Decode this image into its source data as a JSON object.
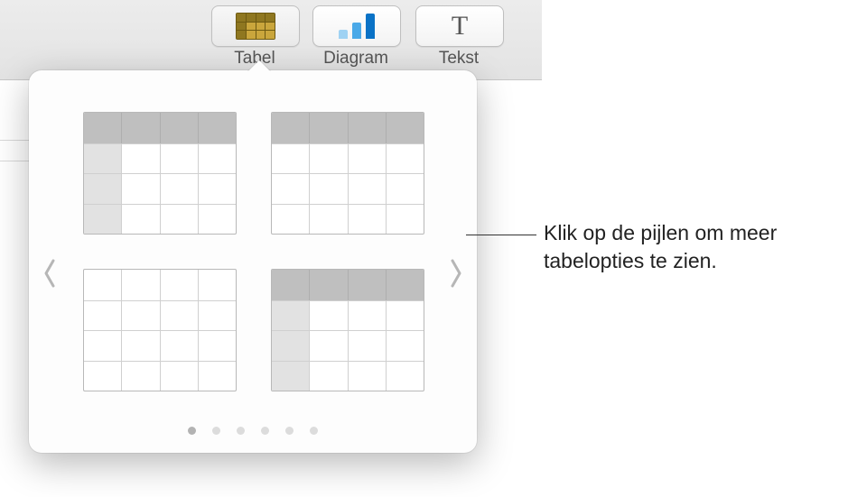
{
  "toolbar": {
    "tabel": {
      "label": "Tabel",
      "icon": "table-icon"
    },
    "diagram": {
      "label": "Diagram",
      "icon": "chart-icon"
    },
    "tekst": {
      "label": "Tekst",
      "icon": "text-icon",
      "glyph": "T"
    }
  },
  "popover": {
    "styles": [
      {
        "header_row": true,
        "header_col": true
      },
      {
        "header_row": true,
        "header_col": false
      },
      {
        "header_row": false,
        "header_col": false
      },
      {
        "header_row": true,
        "header_col": true
      }
    ],
    "nav": {
      "prev": "chevron-left-icon",
      "next": "chevron-right-icon"
    },
    "page_count": 6,
    "active_page": 1
  },
  "callout": {
    "text": "Klik op de pijlen om meer tabelopties te zien."
  }
}
